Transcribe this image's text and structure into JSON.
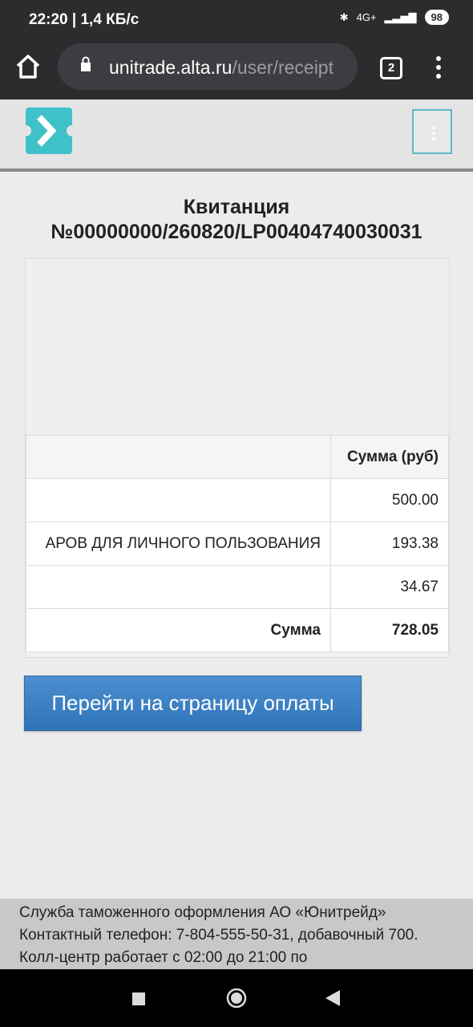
{
  "status_bar": {
    "time": "22:20",
    "speed": "1,4 КБ/с",
    "network": "4G+",
    "battery": "98"
  },
  "browser": {
    "url_host": "unitrade.alta.ru",
    "url_path": "/user/receipt",
    "tabs_count": "2"
  },
  "receipt": {
    "title_line1": "Квитанция",
    "title_line2": "№00000000/260820/LP00404740030031",
    "header_name": "",
    "header_sum": "Сумма (руб)",
    "rows": [
      {
        "name": "",
        "sum": "500.00"
      },
      {
        "name": "АРОВ ДЛЯ ЛИЧНОГО ПОЛЬЗОВАНИЯ",
        "sum": "193.38"
      },
      {
        "name": "",
        "sum": "34.67"
      }
    ],
    "total_label": "Сумма",
    "total_value": "728.05"
  },
  "pay_button_label": "Перейти на страницу оплаты",
  "footer": {
    "text": "Служба таможенного оформления АО «Юнитрейд» Контактный телефон: 7-804-555-50-31, добавочный 700. Колл-центр работает с 02:00 до 21:00 по"
  },
  "colors": {
    "accent": "#3a7fc2",
    "logo": "#3fc1c9"
  }
}
